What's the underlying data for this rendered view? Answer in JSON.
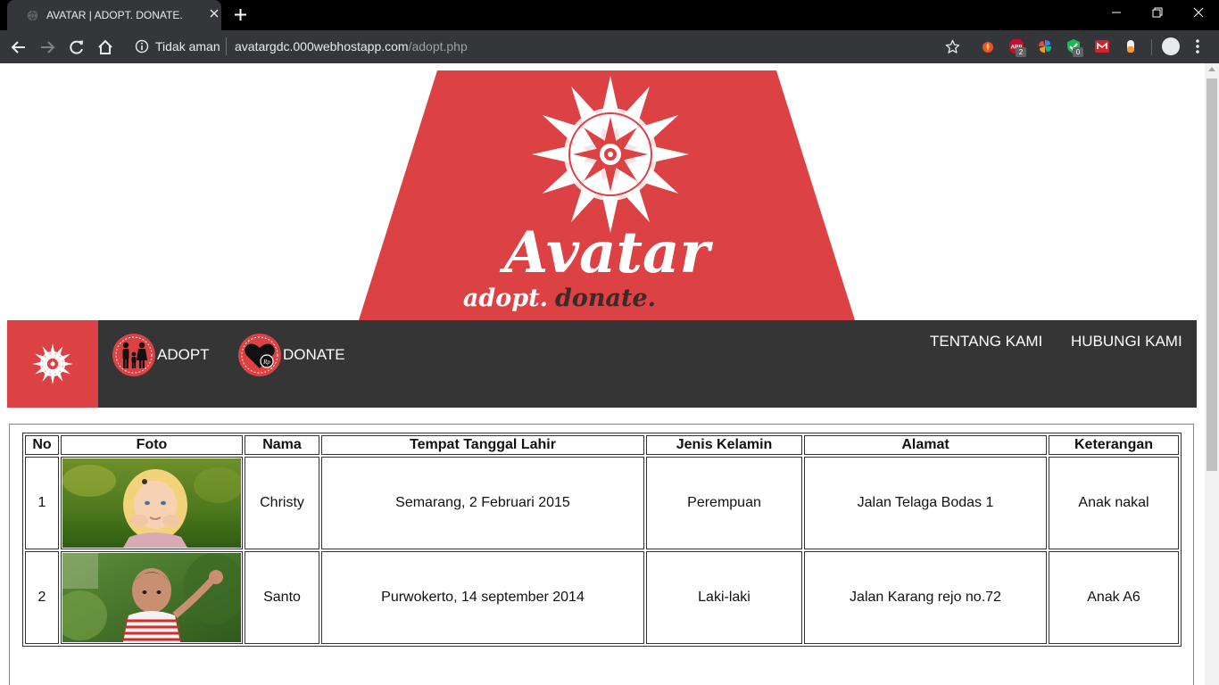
{
  "browser": {
    "tab_title": "AVATAR | ADOPT. DONATE.",
    "security_label": "Tidak aman",
    "url_host": "avatargdc.000webhostapp.com",
    "url_path": "/adopt.php",
    "extensions": [
      {
        "icon": "fire-extension-icon"
      },
      {
        "icon": "abp-extension-icon",
        "badge": "2"
      },
      {
        "icon": "pinwheel-extension-icon"
      },
      {
        "icon": "shield-check-extension-icon",
        "badge": "0"
      },
      {
        "icon": "mega-extension-icon"
      },
      {
        "icon": "capsule-extension-icon"
      }
    ]
  },
  "banner": {
    "brand": "Avatar",
    "tagline_left": "adopt.",
    "tagline_right": "donate."
  },
  "nav": {
    "adopt_label": "ADOPT",
    "donate_label": "DONATE",
    "about_label": "TENTANG KAMI",
    "contact_label": "HUBUNGI KAMI"
  },
  "table": {
    "headers": [
      "No",
      "Foto",
      "Nama",
      "Tempat Tanggal Lahir",
      "Jenis Kelamin",
      "Alamat",
      "Keterangan"
    ],
    "rows": [
      {
        "no": "1",
        "name": "Christy",
        "birth": "Semarang, 2 Februari 2015",
        "gender": "Perempuan",
        "address": "Jalan Telaga Bodas 1",
        "note": "Anak nakal"
      },
      {
        "no": "2",
        "name": "Santo",
        "birth": "Purwokerto, 14 september 2014",
        "gender": "Laki-laki",
        "address": "Jalan Karang rejo no.72",
        "note": "Anak A6"
      }
    ]
  },
  "colors": {
    "brand_red": "#dc4143",
    "nav_dark": "#353535",
    "chrome_dark": "#35363a"
  }
}
